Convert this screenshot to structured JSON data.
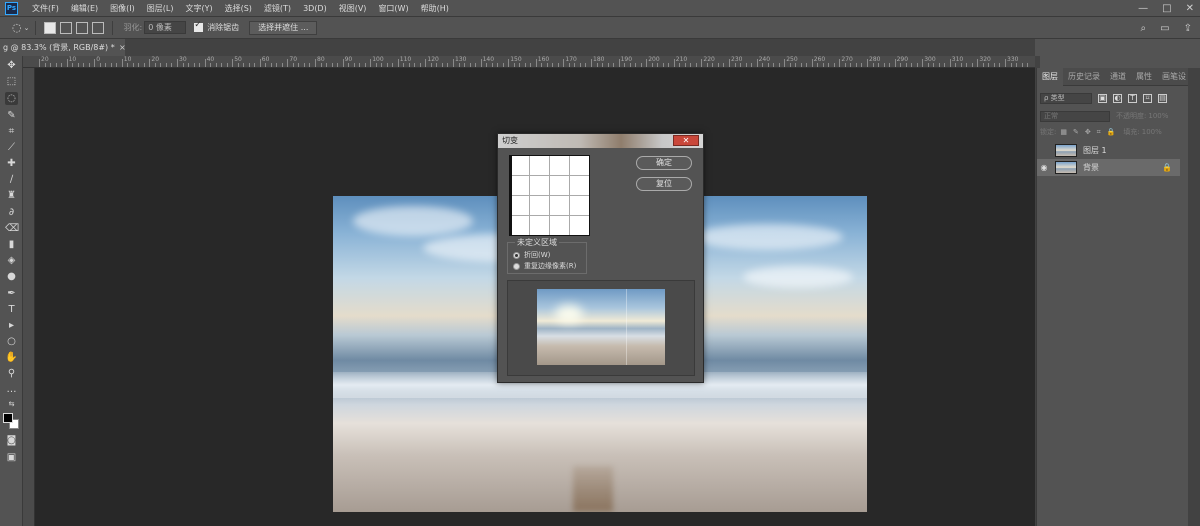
{
  "menu": {
    "logo": "Ps",
    "items": [
      "文件(F)",
      "编辑(E)",
      "图像(I)",
      "图层(L)",
      "文字(Y)",
      "选择(S)",
      "滤镜(T)",
      "3D(D)",
      "视图(V)",
      "窗口(W)",
      "帮助(H)"
    ],
    "window_controls": [
      "—",
      "□",
      "✕"
    ]
  },
  "options": {
    "feather_label": "羽化:",
    "feather_value": "0 像素",
    "antialias_label": "消除锯齿",
    "select_mask_label": "选择并遮住 ..."
  },
  "document": {
    "tab_title": "g @ 83.3% (背景, RGB/8#) *",
    "close": "×"
  },
  "ruler": {
    "top_labels": [
      "20",
      "10",
      "0",
      "10",
      "20",
      "30",
      "40",
      "50",
      "60",
      "70",
      "80",
      "90",
      "100",
      "110",
      "120",
      "130",
      "140",
      "150",
      "160",
      "170",
      "180",
      "190",
      "200",
      "210",
      "220",
      "230",
      "240",
      "250",
      "260",
      "270",
      "280",
      "290",
      "300",
      "310",
      "320",
      "330"
    ]
  },
  "dialog": {
    "title": "切变",
    "close": "✕",
    "ok_label": "确定",
    "reset_label": "复位",
    "undefined_area_label": "未定义区域",
    "wrap_label": "折回(W)",
    "repeat_label": "重复边缘像素(R)"
  },
  "panel": {
    "tabs": [
      "图层",
      "历史记录",
      "通道",
      "属性",
      "画笔设"
    ],
    "filter_kind": "ρ 类型",
    "blend_mode": "正常",
    "opacity_label": "不透明度:",
    "opacity_value": "100%",
    "lock_label": "锁定:",
    "fill_label": "填充:",
    "fill_value": "100%",
    "layers": [
      {
        "name": "图层 1",
        "visible": false,
        "selected": false
      },
      {
        "name": "背景",
        "visible": true,
        "selected": true,
        "locked": true
      }
    ]
  }
}
